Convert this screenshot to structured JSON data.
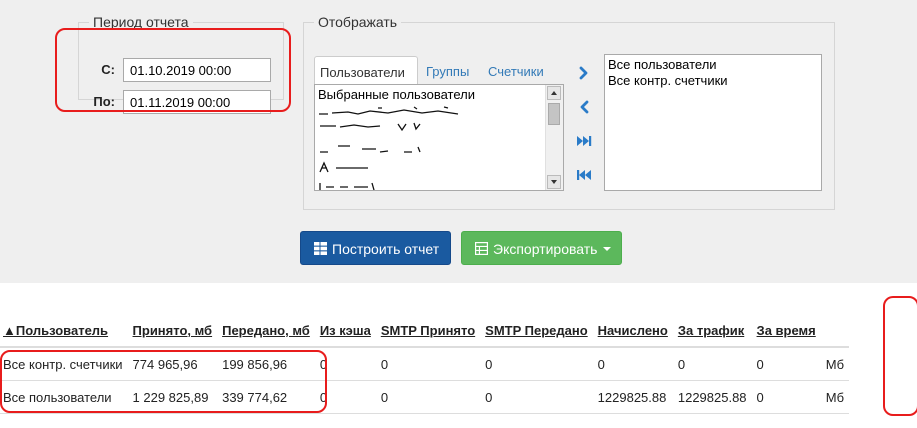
{
  "period": {
    "legend": "Период отчета",
    "from_label": "С:",
    "from_value": "01.10.2019 00:00",
    "to_label": "По:",
    "to_value": "01.11.2019 00:00"
  },
  "display": {
    "legend": "Отображать",
    "tabs": [
      {
        "label": "Пользователи",
        "active": true
      },
      {
        "label": "Группы",
        "active": false
      },
      {
        "label": "Счетчики",
        "active": false
      }
    ],
    "available_list": {
      "items": [
        "Выбранные пользователи"
      ]
    },
    "move_buttons": [
      {
        "icon": "chevron-right-icon"
      },
      {
        "icon": "chevron-left-icon"
      },
      {
        "icon": "fast-forward-icon"
      },
      {
        "icon": "fast-backward-icon"
      }
    ],
    "selected_list": {
      "items": [
        "Все пользователи",
        "Все контр. счетчики"
      ]
    }
  },
  "actions": {
    "build_label": "Построить отчет",
    "build_icon": "table-icon",
    "export_label": "Экспортировать",
    "export_icon": "spreadsheet-icon"
  },
  "table": {
    "headers": [
      "▲Пользователь",
      "Принято, мб",
      "Передано, мб",
      "Из кэша",
      "SMTP Принято",
      "SMTP Передано",
      "Начислено",
      "За трафик",
      "За время",
      ""
    ],
    "rows": [
      [
        "Все контр. счетчики",
        "774 965,96",
        "199 856,96",
        "0",
        "0",
        "0",
        "0",
        "0",
        "0",
        "Мб"
      ],
      [
        "Все пользователи",
        "1 229 825,89",
        "339 774,62",
        "0",
        "0",
        "0",
        "1229825.88",
        "1229825.88",
        "0",
        "Мб"
      ]
    ]
  },
  "colors": {
    "accent_link": "#337ab7",
    "primary_button": "#1a5aa0",
    "success_button": "#5cb85c",
    "annotation_red": "#e81c1c"
  }
}
